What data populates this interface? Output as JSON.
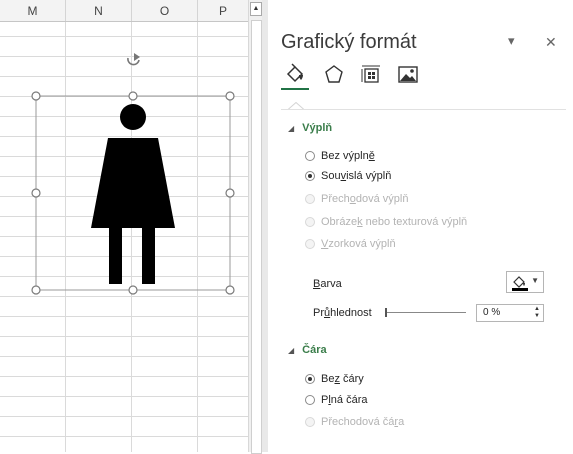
{
  "spreadsheet": {
    "columns": [
      "M",
      "N",
      "O",
      "P"
    ]
  },
  "pane": {
    "title": "Grafický formát",
    "dropdown_glyph": "▾",
    "close_glyph": "✕",
    "tabs": [
      "fill-and-line-icon",
      "effects-icon",
      "size-properties-icon",
      "picture-icon"
    ],
    "fill": {
      "header": "Výplň",
      "options": [
        {
          "pre": "Bez výpln",
          "u": "ě",
          "post": "",
          "state": "unselected"
        },
        {
          "pre": "Sou",
          "u": "v",
          "post": "islá výplň",
          "state": "selected"
        },
        {
          "pre": "Přech",
          "u": "o",
          "post": "dová výplň",
          "state": "disabled"
        },
        {
          "pre": "Obráze",
          "u": "k",
          "post": " nebo texturová výplň",
          "state": "disabled"
        },
        {
          "pre": "",
          "u": "V",
          "post": "zorková výplň",
          "state": "disabled"
        }
      ],
      "color_label_u": "B",
      "color_label_post": "arva",
      "transparency_label_pre": "Pr",
      "transparency_label_u": "ů",
      "transparency_label_post": "hlednost",
      "transparency_value": "0 %"
    },
    "line": {
      "header": "Čára",
      "options": [
        {
          "pre": "Be",
          "u": "z",
          "post": " čáry",
          "state": "selected"
        },
        {
          "pre": "P",
          "u": "l",
          "post": "ná čára",
          "state": "unselected"
        },
        {
          "pre": "Přechodová čá",
          "u": "r",
          "post": "a",
          "state": "disabled"
        }
      ]
    }
  },
  "colors": {
    "accent_green": "#3a7d4a",
    "tab_underline": "#217346",
    "figure": "#000000"
  }
}
